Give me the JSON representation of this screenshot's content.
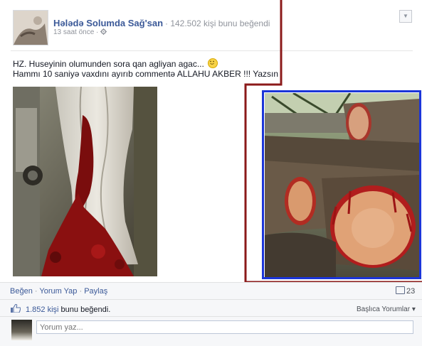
{
  "post": {
    "author": "Hələdə Solumda Sağ'san",
    "page_likes": "· 142.502 kişi bunu beğendi",
    "time": "13 saat önce",
    "separator": "·",
    "privacy_icon": "gear-icon",
    "message_line1": "HZ. Huseyinin olumunden sora qan agliyan agac...",
    "message_line2": "Hammı 10 saniyə vaxdını ayırıb commentə ALLAHU AKBER !!! Yazsın",
    "photos": [
      {
        "name": "bleeding-tree-trunk-photo"
      },
      {
        "name": "cut-logs-photo"
      }
    ]
  },
  "actions": {
    "like": "Beğen",
    "comment": "Yorum Yap",
    "share": "Paylaş",
    "dot": "·",
    "comment_count": "23"
  },
  "likes": {
    "count": "1.852 kişi",
    "text": "bunu beğendi."
  },
  "sort": {
    "label": "Başlıca Yorumlar",
    "arrow": "▾"
  },
  "comment_input": {
    "placeholder": "Yorum yaz..."
  },
  "colors": {
    "link": "#3b5998",
    "annotation_red": "#8b1a1a",
    "annotation_blue": "#1b35d8"
  }
}
